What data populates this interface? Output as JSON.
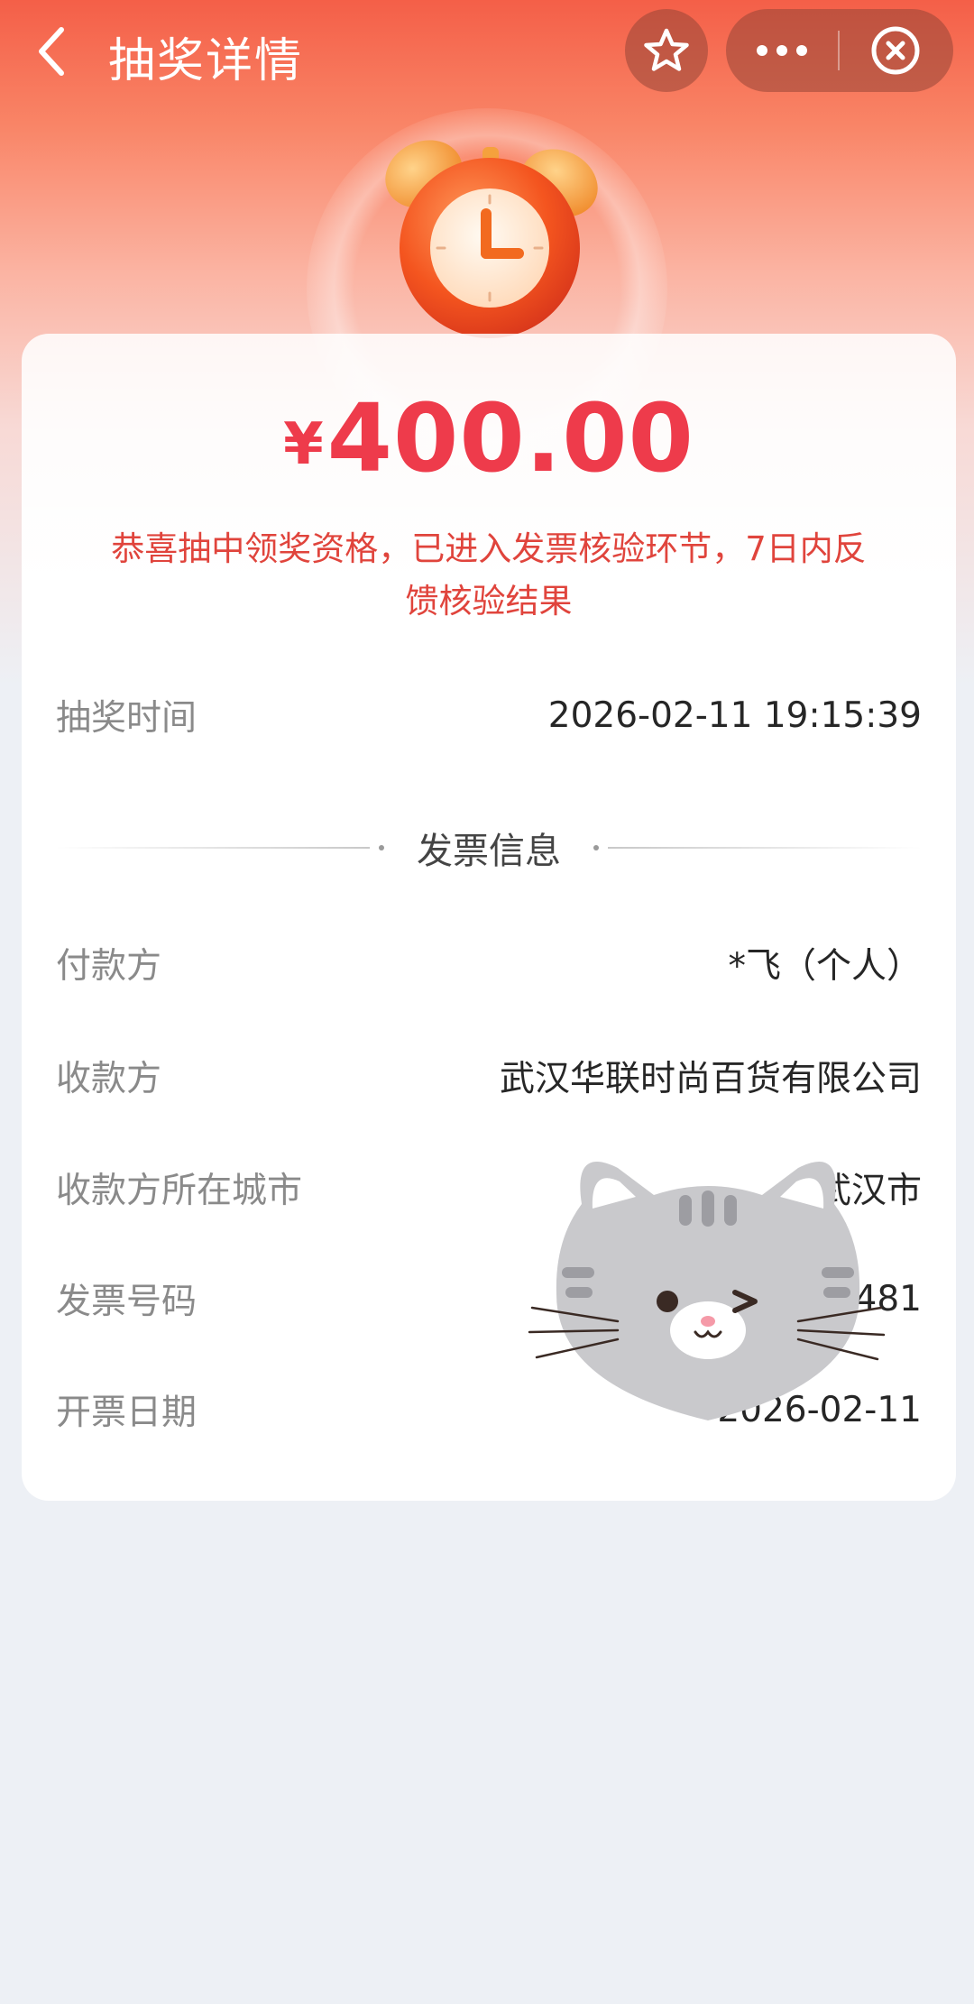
{
  "nav": {
    "title": "抽奖详情",
    "icons": [
      "back-arrow-icon",
      "star-icon",
      "more-dots-icon",
      "close-circle-icon"
    ]
  },
  "prize": {
    "currency_symbol": "¥",
    "amount": "400.00",
    "message": "恭喜抽中领奖资格，已进入发票核验环节，7日内反馈核验结果"
  },
  "draw": {
    "time_label": "抽奖时间",
    "time_value": "2026-02-11 19:15:39"
  },
  "invoice": {
    "section_title": "发票信息",
    "rows": [
      {
        "label": "付款方",
        "value": "*飞（个人）"
      },
      {
        "label": "收款方",
        "value": "武汉华联时尚百货有限公司"
      },
      {
        "label": "收款方所在城市",
        "value": "武汉市"
      },
      {
        "label": "发票号码",
        "value": "26                    481"
      },
      {
        "label": "开票日期",
        "value": "2026-02-11"
      }
    ]
  },
  "colors": {
    "accent": "#ee3b4b",
    "message": "#e0443c",
    "hero_top": "#f45f48",
    "page_bg": "#edf0f5"
  }
}
